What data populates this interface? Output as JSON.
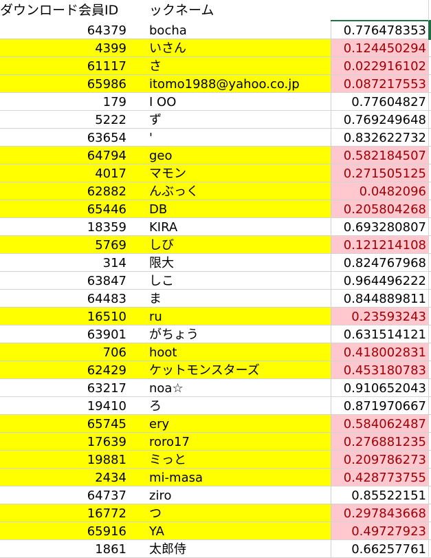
{
  "header": {
    "col_id": "ダウンロード会員ID",
    "col_nick": "ックネーム",
    "col_val": ""
  },
  "rows": [
    {
      "id": "64379",
      "nick": "bocha",
      "val": "0.776478353",
      "hl": false
    },
    {
      "id": "4399",
      "nick": "いさん",
      "val": "0.124450294",
      "hl": true
    },
    {
      "id": "61117",
      "nick": "さ",
      "val": "0.022916102",
      "hl": true
    },
    {
      "id": "65986",
      "nick": "itomo1988@yahoo.co.jp",
      "val": "0.087217553",
      "hl": true
    },
    {
      "id": "179",
      "nick": "I OO",
      "val": "0.77604827",
      "hl": false
    },
    {
      "id": "5222",
      "nick": "ず",
      "val": "0.769249648",
      "hl": false
    },
    {
      "id": "63654",
      "nick": "'",
      "val": "0.832622732",
      "hl": false
    },
    {
      "id": "64794",
      "nick": "geo",
      "val": "0.582184507",
      "hl": true
    },
    {
      "id": "4017",
      "nick": "マモン",
      "val": "0.271505125",
      "hl": true
    },
    {
      "id": "62882",
      "nick": "んぶっく",
      "val": "0.0482096",
      "hl": true
    },
    {
      "id": "65446",
      "nick": "DB",
      "val": "0.205804268",
      "hl": true
    },
    {
      "id": "18359",
      "nick": "KIRA",
      "val": "0.693280807",
      "hl": false
    },
    {
      "id": "5769",
      "nick": "しび",
      "val": "0.121214108",
      "hl": true
    },
    {
      "id": "314",
      "nick": "限大",
      "val": "0.824767968",
      "hl": false
    },
    {
      "id": "63847",
      "nick": "しこ",
      "val": "0.964496222",
      "hl": false
    },
    {
      "id": "64483",
      "nick": "ま",
      "val": "0.844889811",
      "hl": false
    },
    {
      "id": "16510",
      "nick": "ru",
      "val": "0.23593243",
      "hl": true
    },
    {
      "id": "63901",
      "nick": "がちょう",
      "val": "0.631514121",
      "hl": false
    },
    {
      "id": "706",
      "nick": "hoot",
      "val": "0.418002831",
      "hl": true
    },
    {
      "id": "62429",
      "nick": "ケットモンスターズ",
      "val": "0.453180783",
      "hl": true
    },
    {
      "id": "63217",
      "nick": "noa☆",
      "val": "0.910652043",
      "hl": false
    },
    {
      "id": "19410",
      "nick": "ろ",
      "val": "0.871970667",
      "hl": false
    },
    {
      "id": "65745",
      "nick": "ery",
      "val": "0.584062487",
      "hl": true
    },
    {
      "id": "17639",
      "nick": "roro17",
      "val": "0.276881235",
      "hl": true
    },
    {
      "id": "19881",
      "nick": "ミっと",
      "val": "0.209786273",
      "hl": true
    },
    {
      "id": "2434",
      "nick": "mi-masa",
      "val": "0.428773755",
      "hl": true
    },
    {
      "id": "64737",
      "nick": "ziro",
      "val": "0.85522151",
      "hl": false
    },
    {
      "id": "16772",
      "nick": "つ",
      "val": "0.297843668",
      "hl": true
    },
    {
      "id": "65916",
      "nick": "YA",
      "val": "0.49727923",
      "hl": true
    },
    {
      "id": "1861",
      "nick": "太郎侍",
      "val": "0.66257761",
      "hl": false
    }
  ],
  "colors": {
    "highlight_yellow": "#ffff00",
    "highlight_pink": "#ffc7ce",
    "highlight_text": "#9c0006",
    "selection_green": "#1e7145"
  }
}
